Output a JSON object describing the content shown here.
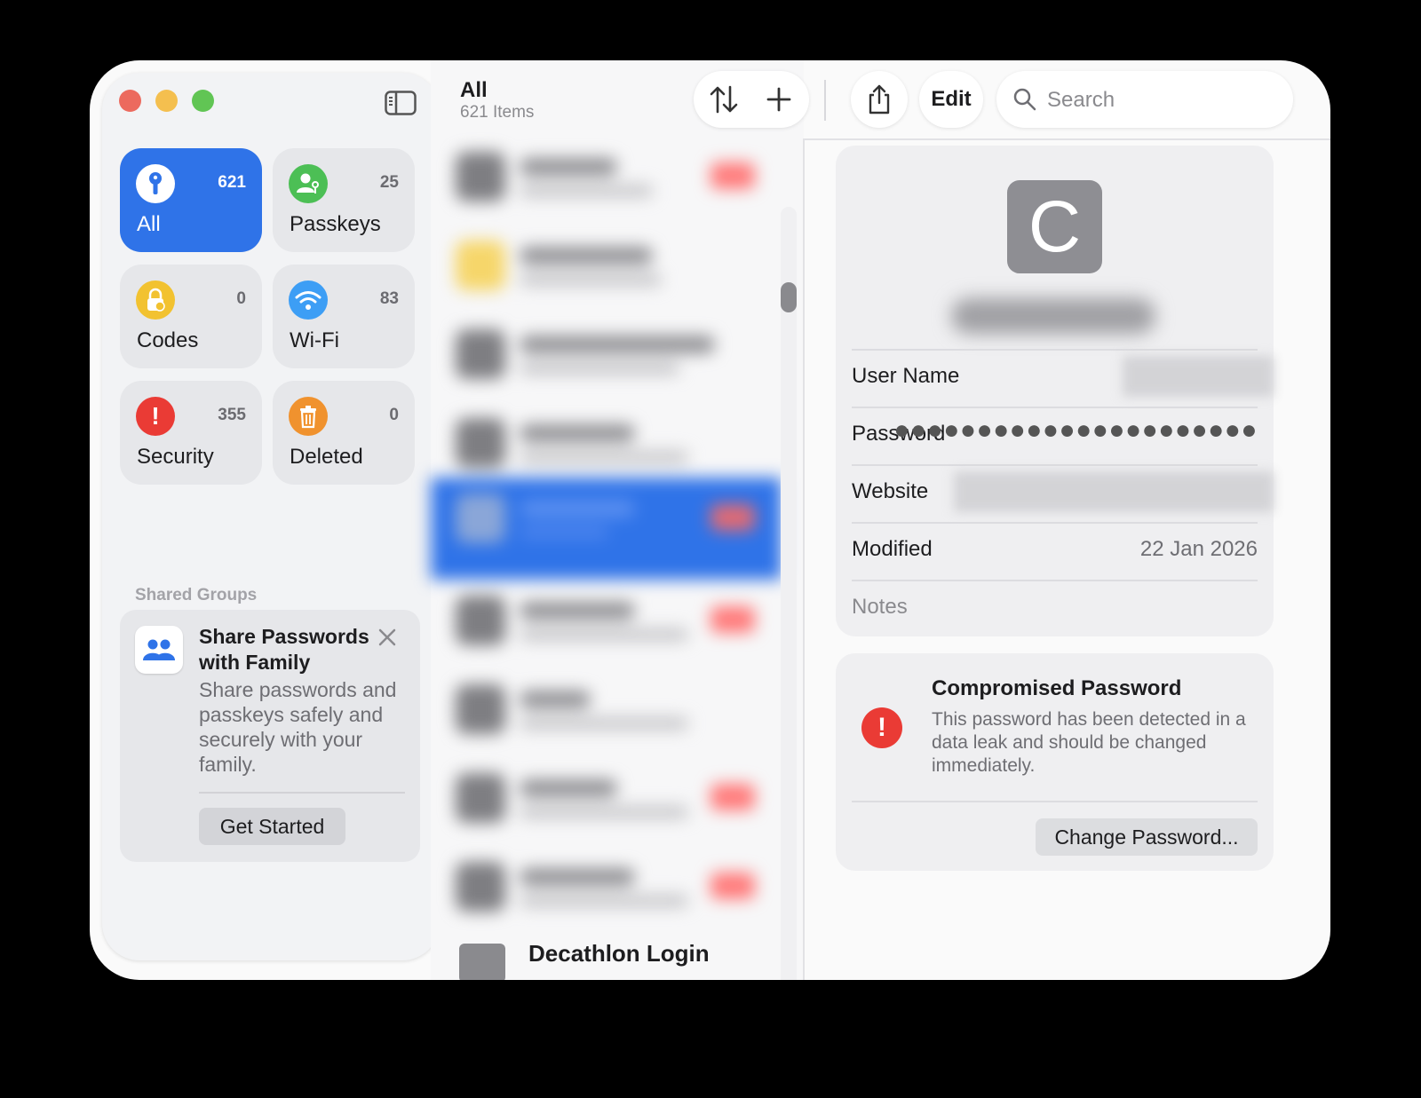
{
  "sidebar": {
    "categories": [
      {
        "label": "All",
        "count": "621",
        "icon": "key-icon",
        "color": "#2f73e8",
        "selected": true
      },
      {
        "label": "Passkeys",
        "count": "25",
        "icon": "passkey-person-icon",
        "color": "#4cbf55"
      },
      {
        "label": "Codes",
        "count": "0",
        "icon": "lock-clock-icon",
        "color": "#f2c230"
      },
      {
        "label": "Wi-Fi",
        "count": "83",
        "icon": "wifi-icon",
        "color": "#3d9ef5"
      },
      {
        "label": "Security",
        "count": "355",
        "icon": "exclamation-icon",
        "color": "#ea3b35"
      },
      {
        "label": "Deleted",
        "count": "0",
        "icon": "trash-icon",
        "color": "#f0922e"
      }
    ],
    "shared_groups_title": "Shared Groups",
    "share_card": {
      "title": "Share Passwords with Family",
      "description": "Share passwords and passkeys safely and securely with your family.",
      "button": "Get Started"
    }
  },
  "list": {
    "title": "All",
    "subtitle": "621 Items",
    "last_visible_item": "Decathlon Login"
  },
  "toolbar": {
    "edit_label": "Edit",
    "search_placeholder": "Search"
  },
  "detail": {
    "avatar_letter": "C",
    "fields": {
      "username_label": "User Name",
      "password_label": "Password",
      "password_value": "●●●●●●●●●●●●●●●●●●●●●●",
      "website_label": "Website",
      "modified_label": "Modified",
      "modified_value": "22 Jan 2026",
      "notes_label": "Notes"
    },
    "warning": {
      "title": "Compromised Password",
      "description": "This password has been detected in a data leak and should be changed immediately.",
      "button": "Change Password..."
    }
  },
  "colors": {
    "accent": "#2f73e8",
    "danger": "#ea3b35"
  }
}
